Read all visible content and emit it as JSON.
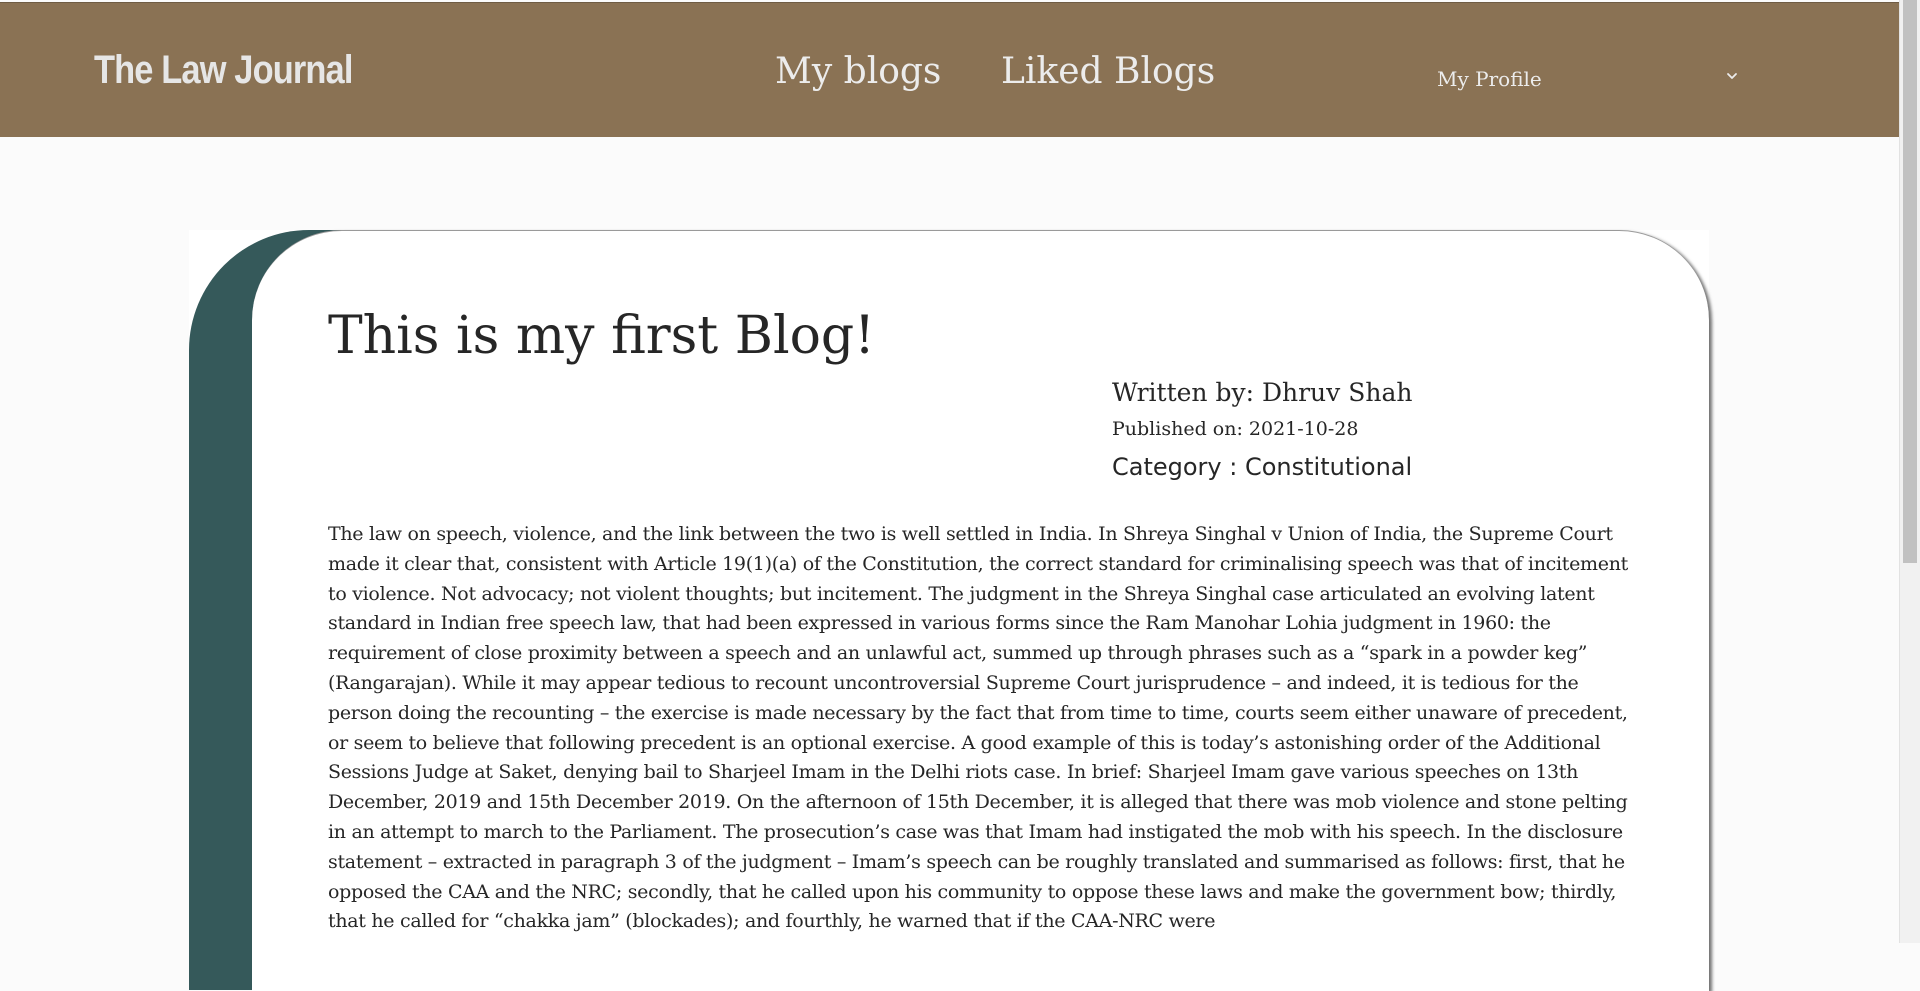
{
  "navbar": {
    "brand": "The Law Journal",
    "links": [
      {
        "label": "My blogs"
      },
      {
        "label": "Liked Blogs"
      }
    ],
    "profile_label": "My Profile",
    "profile_icon": "chevron-down-icon"
  },
  "colors": {
    "navbar_bg": "#8a7254",
    "card_accent": "#35595a",
    "page_bg": "#fbfbfb",
    "text": "#262626"
  },
  "post": {
    "title": "This is my first Blog!",
    "author_line": "Written by: Dhruv Shah",
    "published_line": "Published on: 2021-10-28",
    "category_line": "Category : Constitutional",
    "body": "The law on speech, violence, and the link between the two is well settled in India. In Shreya Singhal v Union of India, the Supreme Court made it clear that, consistent with Article 19(1)(a) of the Constitution, the correct standard for criminalising speech was that of incitement to violence. Not advocacy; not violent thoughts; but incitement. The judgment in the Shreya Singhal case articulated an evolving latent standard in Indian free speech law, that had been expressed in various forms since the Ram Manohar Lohia judgment in 1960: the requirement of close proximity between a speech and an unlawful act, summed up through phrases such as a “spark in a powder keg” (Rangarajan). While it may appear tedious to recount uncontroversial Supreme Court jurisprudence – and indeed, it is tedious for the person doing the recounting – the exercise is made necessary by the fact that from time to time, courts seem either unaware of precedent, or seem to believe that following precedent is an optional exercise. A good example of this is today’s astonishing order of the Additional Sessions Judge at Saket, denying bail to Sharjeel Imam in the Delhi riots case. In brief: Sharjeel Imam gave various speeches on 13th December, 2019 and 15th December 2019. On the afternoon of 15th December, it is alleged that there was mob violence and stone pelting in an attempt to march to the Parliament. The prosecution’s case was that Imam had instigated the mob with his speech. In the disclosure statement – extracted in paragraph 3 of the judgment – Imam’s speech can be roughly translated and summarised as follows: first, that he opposed the CAA and the NRC; secondly, that he called upon his community to oppose these laws and make the government bow; thirdly, that he called for “chakka jam” (blockades); and fourthly, he warned that if the CAA-NRC were"
  }
}
